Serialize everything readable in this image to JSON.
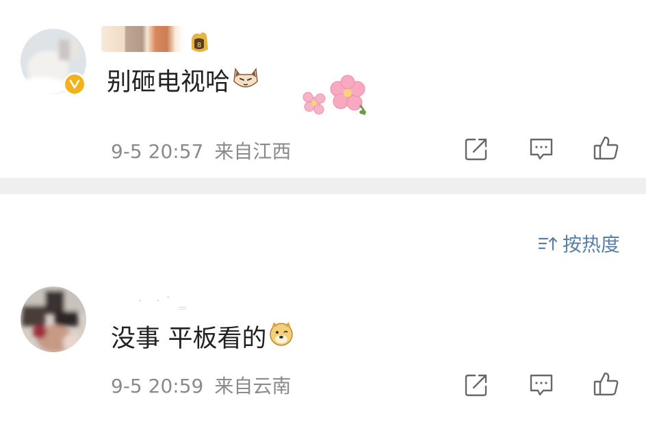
{
  "comments": [
    {
      "text": "别砸电视哈",
      "emoji": "cat-face-emoji",
      "badge": "verified-badge-icon",
      "time": "9-5 20:57",
      "location": "来自江西"
    },
    {
      "text": "没事 平板看的",
      "emoji": "doge-emoji",
      "time": "9-5 20:59",
      "location": "来自云南"
    }
  ],
  "sort": {
    "label": "按热度",
    "icon": "sort-icon"
  },
  "actions": [
    "share-icon",
    "comment-icon",
    "like-icon"
  ],
  "colors": {
    "meta_text": "#8a8a8a",
    "comment_text": "#222222",
    "sort_link": "#5a7fa6",
    "separator": "#efefef",
    "verified_badge": "#f2b21b"
  }
}
